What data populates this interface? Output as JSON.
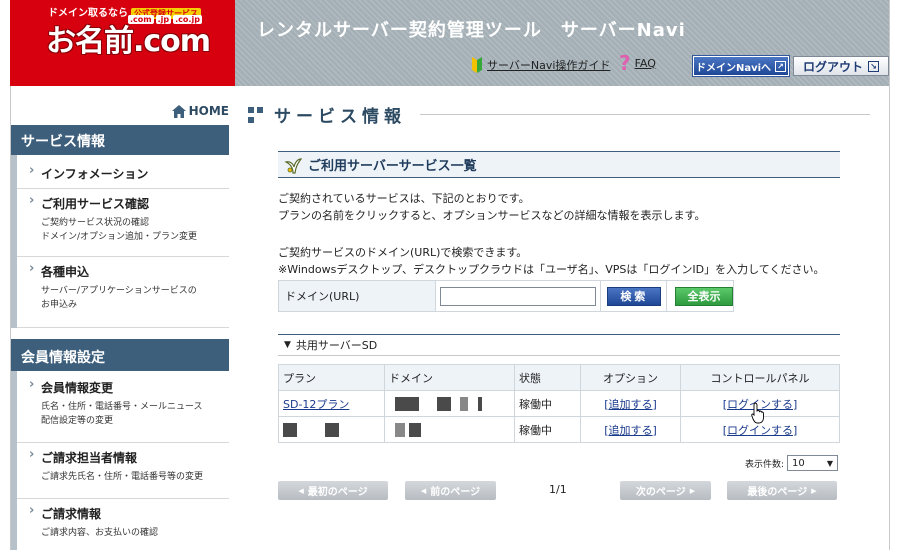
{
  "header": {
    "logo_tagline": "ドメイン取るなら",
    "logo_badge": "公式登録サービス",
    "logo_tlds": [
      ".com",
      ".jp",
      ".co.jp"
    ],
    "logo_main": "お名前.com",
    "app_title": "レンタルサーバー契約管理ツール　サーバーNavi",
    "guide_label": "サーバーNavi操作ガイド",
    "faq_label": "FAQ",
    "domain_navi_button": "ドメインNaviへ",
    "logout_button": "ログアウト"
  },
  "sidebar": {
    "home_label": "HOME",
    "sections": [
      {
        "title": "サービス情報",
        "items": [
          {
            "label": "インフォメーション",
            "desc": ""
          },
          {
            "label": "ご利用サービス確認",
            "desc": "ご契約サービス状況の確認\nドメイン/オプション追加・プラン変更"
          },
          {
            "label": "各種申込",
            "desc": "サーバー/アプリケーションサービスの\nお申込み"
          }
        ]
      },
      {
        "title": "会員情報設定",
        "items": [
          {
            "label": "会員情報変更",
            "desc": "氏名・住所・電話番号・メールニュース\n配信設定等の変更"
          },
          {
            "label": "ご請求担当者情報",
            "desc": "ご請求先氏名・住所・電話番号等の変更"
          },
          {
            "label": "ご請求情報",
            "desc": "ご請求内容、お支払いの確認"
          }
        ]
      }
    ]
  },
  "main": {
    "page_title": "サービス情報",
    "box_title": "ご利用サーバーサービス一覧",
    "intro_line1": "ご契約されているサービスは、下記のとおりです。",
    "intro_line2": "プランの名前をクリックすると、オプションサービスなどの詳細な情報を表示します。",
    "search_note1": "ご契約サービスのドメイン(URL)で検索できます。",
    "search_note2": "※Windowsデスクトップ、デスクトップクラウドは「ユーザ名」、VPSは「ログインID」を入力してください。",
    "search_label": "ドメイン(URL)",
    "search_value": "",
    "search_button": "検索",
    "show_all_button": "全表示",
    "group_title": "共用サーバーSD",
    "table": {
      "headers": [
        "プラン",
        "ドメイン",
        "状態",
        "オプション",
        "コントロールパネル"
      ],
      "rows": [
        {
          "plan": "SD-12プラン",
          "status": "稼働中",
          "option": "[追加する]",
          "panel": "[ログインする]"
        },
        {
          "plan": "",
          "status": "稼働中",
          "option": "[追加する]",
          "panel": "[ログインする]"
        }
      ]
    },
    "per_page_label": "表示件数:",
    "per_page_value": "10",
    "pager": {
      "first": "最初のページ",
      "prev": "前のページ",
      "info": "1/1",
      "next": "次のページ",
      "last": "最後のページ"
    }
  }
}
